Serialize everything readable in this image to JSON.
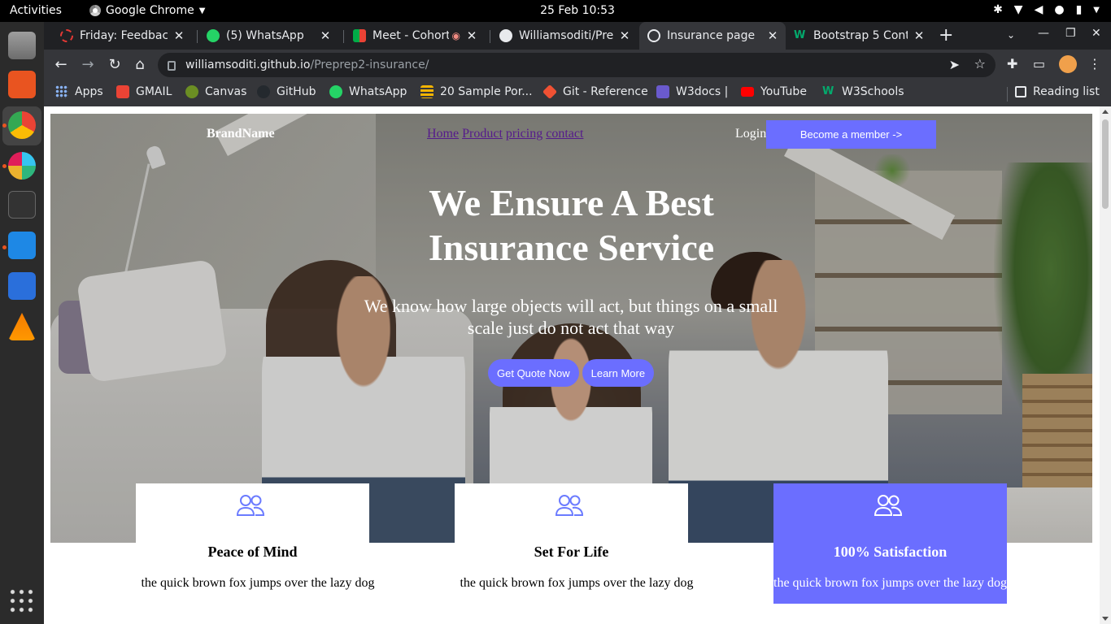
{
  "system": {
    "activities": "Activities",
    "app_name": "Google Chrome",
    "clock": "25 Feb  10:53"
  },
  "browser": {
    "tabs": [
      {
        "title": "Friday: Feedback",
        "favicon": "ring-icon",
        "color": "#e53935"
      },
      {
        "title": "(5) WhatsApp",
        "favicon": "whatsapp-icon",
        "color": "#25d366"
      },
      {
        "title": "Meet - Cohort",
        "favicon": "meet-icon",
        "color": "#00ac47"
      },
      {
        "title": "Williamsoditi/Pre",
        "favicon": "github-icon",
        "color": "#e8eaed"
      },
      {
        "title": "Insurance page",
        "favicon": "globe-icon",
        "color": "#e8eaed",
        "active": true
      },
      {
        "title": "Bootstrap 5 Cont",
        "favicon": "w3-icon",
        "color": "#04aa6d"
      }
    ],
    "url_host": "williamsoditi.github.io",
    "url_path": "/Preprep2-insurance/",
    "bookmarks": [
      {
        "label": "Apps",
        "color": "#4285f4"
      },
      {
        "label": "GMAIL",
        "color": "#ea4335"
      },
      {
        "label": "Canvas",
        "color": "#6b8e23"
      },
      {
        "label": "GitHub",
        "color": "#24292e"
      },
      {
        "label": "WhatsApp",
        "color": "#25d366"
      },
      {
        "label": "20 Sample Por...",
        "color": "#f4b400"
      },
      {
        "label": "Git - Reference",
        "color": "#f05133"
      },
      {
        "label": "W3docs |",
        "color": "#6a5acd"
      },
      {
        "label": "YouTube",
        "color": "#ff0000"
      },
      {
        "label": "W3Schools",
        "color": "#04aa6d"
      }
    ],
    "reading_list": "Reading list"
  },
  "page": {
    "brand": "BrandName",
    "nav_links": [
      "Home",
      "Product",
      "pricing",
      "contact"
    ],
    "login": "Login",
    "member_button": "Become a member ->",
    "headline_line1": "We Ensure A Best",
    "headline_line2": "Insurance Service",
    "subtitle": "We know how large objects will act, but things on a small scale just do not act that way",
    "quote_button": "Get Quote Now",
    "learn_button": "Learn More",
    "accent_color": "#6b6eff",
    "cards": [
      {
        "title": "Peace of Mind",
        "text": "the quick brown fox jumps over the lazy dog",
        "icon": "users-icon"
      },
      {
        "title": "Set For Life",
        "text": "the quick brown fox jumps over the lazy dog",
        "icon": "users-icon"
      },
      {
        "title": "100% Satisfaction",
        "text": "the quick brown fox jumps over the lazy dog",
        "icon": "users-icon",
        "featured": true
      }
    ]
  }
}
